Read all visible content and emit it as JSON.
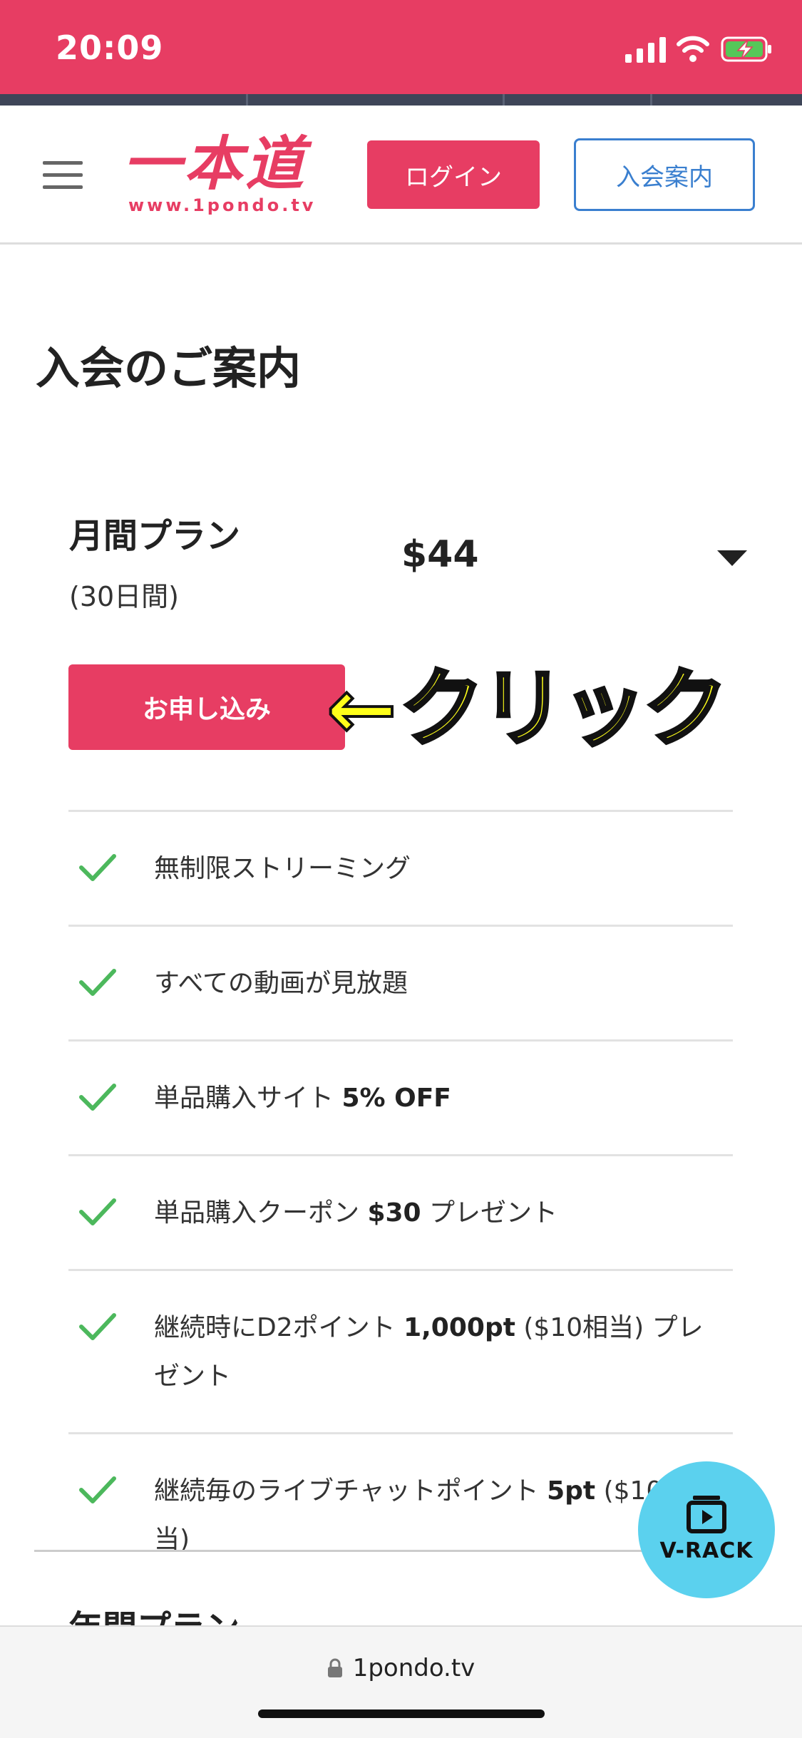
{
  "status_bar": {
    "time": "20:09",
    "bg_color": "#e73d63"
  },
  "header": {
    "logo_text": "一本道",
    "logo_url": "www.1pondo.tv",
    "login_label": "ログイン",
    "join_label": "入会案内"
  },
  "main": {
    "title": "入会のご案内",
    "plan": {
      "name": "月間プラン",
      "duration": "(30日間)",
      "price": "$44",
      "apply_label": "お申し込み"
    },
    "annotation": {
      "arrow": "←",
      "text": "クリック"
    },
    "features": [
      {
        "text": "無制限ストリーミング"
      },
      {
        "text": "すべての動画が見放題"
      },
      {
        "pre": "単品購入サイト ",
        "bold": "5% OFF",
        "post": ""
      },
      {
        "pre": "単品購入クーポン ",
        "bold": "$30",
        "post": " プレゼント"
      },
      {
        "pre": "継続時にD2ポイント ",
        "bold": "1,000pt",
        "post": " ($10相当) プレゼント"
      },
      {
        "pre": "継続毎のライブチャットポイント ",
        "bold": "5pt",
        "post": " ($10相当)"
      }
    ],
    "next_plan_partial": "年間プラン"
  },
  "fab": {
    "label": "V-RACK"
  },
  "browser": {
    "url": "1pondo.tv"
  },
  "colors": {
    "accent": "#e73d63",
    "link": "#3a7fcf",
    "check": "#4cb85c",
    "fab": "#5bd1ee"
  }
}
